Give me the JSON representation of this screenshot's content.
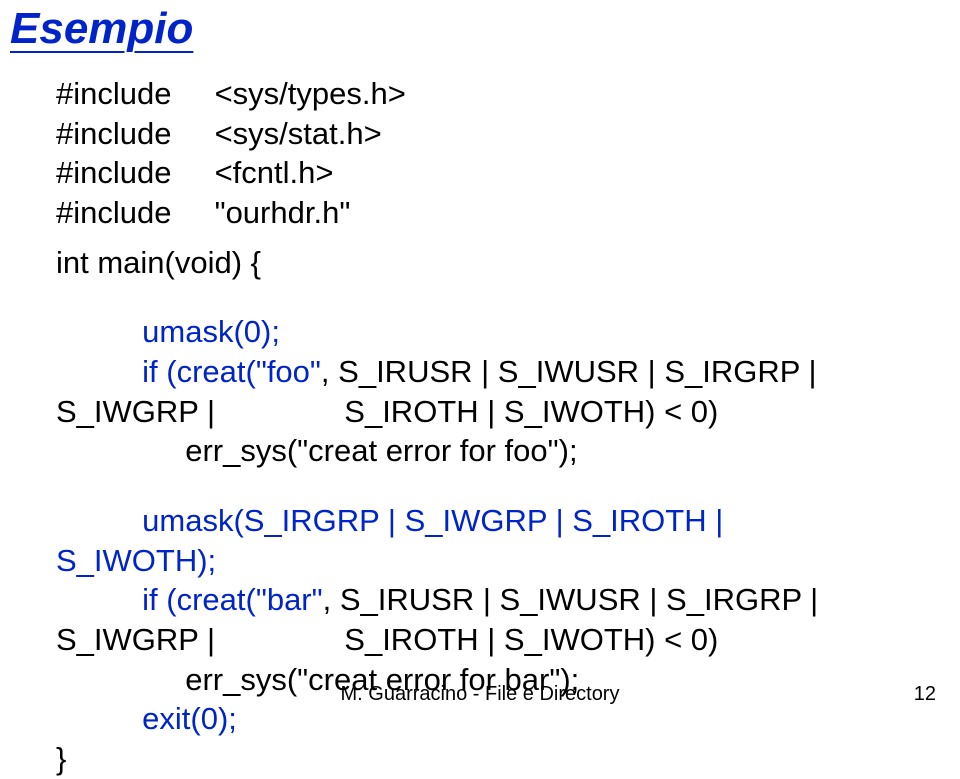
{
  "title": "Esempio",
  "includes": [
    {
      "directive": "#include",
      "value": "<sys/types.h>"
    },
    {
      "directive": "#include",
      "value": "<sys/stat.h>"
    },
    {
      "directive": "#include",
      "value": "<fcntl.h>"
    },
    {
      "directive": "#include",
      "value": "\"ourhdr.h\""
    }
  ],
  "main_decl": "int main(void) {",
  "umask0": "umask(0);",
  "creat_foo_if": "if (creat(\"foo\"",
  "creat_foo_flags1": ", S_IRUSR | S_IWUSR | S_IRGRP |",
  "creat_foo_line2_left": "S_IWGRP |",
  "creat_foo_line2_right": "S_IROTH | S_IWOTH) < 0)",
  "err_foo": "err_sys(\"creat error for foo\");",
  "umask_mask": "umask(S_IRGRP | S_IWGRP | S_IROTH |",
  "umask_mask_line2": "S_IWOTH);",
  "creat_bar_if": "if (creat(\"bar\"",
  "creat_bar_flags1": ", S_IRUSR | S_IWUSR | S_IRGRP |",
  "creat_bar_line2_left": "S_IWGRP |",
  "creat_bar_line2_right": "S_IROTH | S_IWOTH) < 0)",
  "err_bar": "err_sys(\"creat error for bar\");",
  "exit0": "exit(0);",
  "close_brace": "}",
  "footer_center": "M. Guarracino - File e Directory",
  "footer_right": "12"
}
